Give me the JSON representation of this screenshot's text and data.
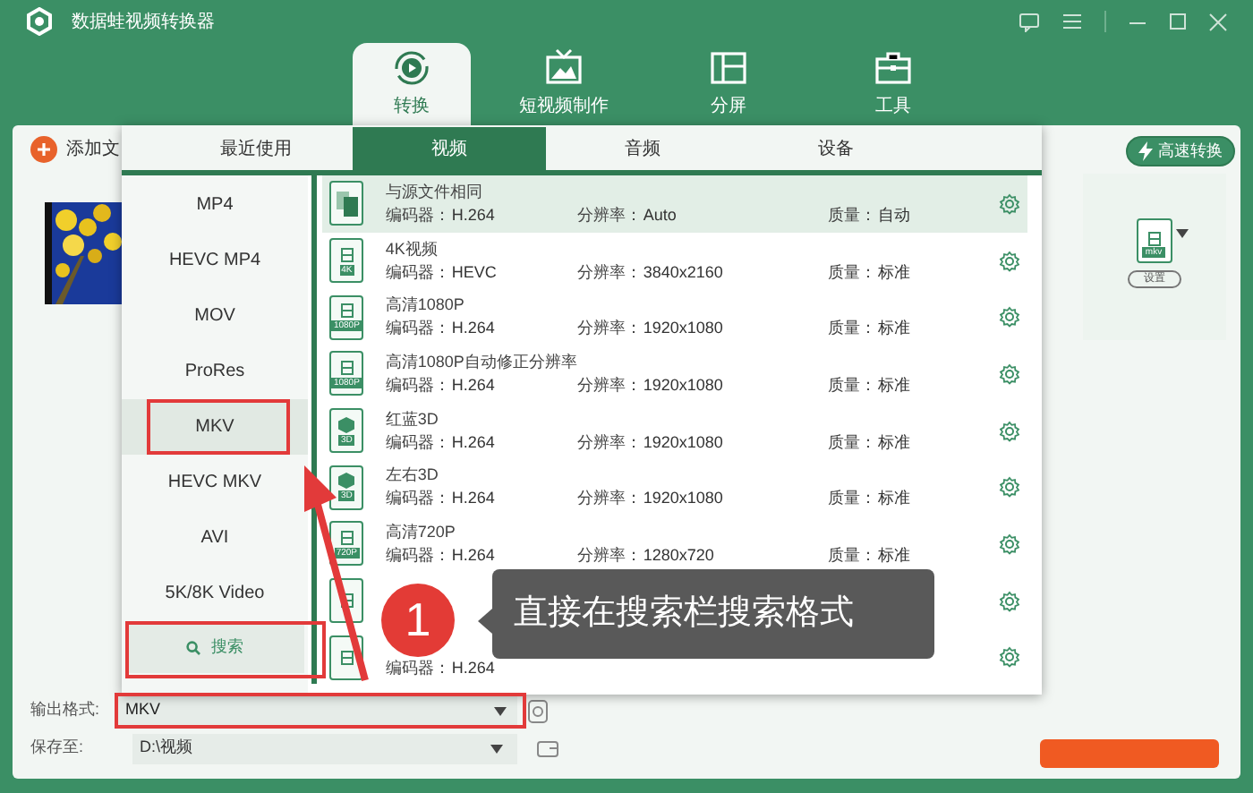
{
  "window": {
    "title": "数据蛙视频转换器"
  },
  "main_tabs": [
    {
      "label": "转换",
      "selected": true
    },
    {
      "label": "短视频制作",
      "selected": false
    },
    {
      "label": "分屏",
      "selected": false
    },
    {
      "label": "工具",
      "selected": false
    }
  ],
  "toolbar": {
    "add_file": "添加文",
    "fast_convert": "高速转换"
  },
  "output_panel": {
    "format_badge": "mkv",
    "settings_button": "设置"
  },
  "format_popup": {
    "tabs": [
      {
        "label": "最近使用",
        "selected": false
      },
      {
        "label": "视频",
        "selected": true
      },
      {
        "label": "音频",
        "selected": false
      },
      {
        "label": "设备",
        "selected": false
      }
    ],
    "categories": [
      {
        "label": "MP4",
        "selected": false
      },
      {
        "label": "HEVC MP4",
        "selected": false
      },
      {
        "label": "MOV",
        "selected": false
      },
      {
        "label": "ProRes",
        "selected": false
      },
      {
        "label": "MKV",
        "selected": true
      },
      {
        "label": "HEVC MKV",
        "selected": false
      },
      {
        "label": "AVI",
        "selected": false
      },
      {
        "label": "5K/8K Video",
        "selected": false
      }
    ],
    "search_button": "搜索",
    "presets": [
      {
        "kind": "same",
        "name": "与源文件相同",
        "codec_label": "编码器：",
        "codec": "H.264",
        "resolution_label": "分辨率：",
        "resolution": "Auto",
        "quality_label": "质量：",
        "quality": "自动",
        "selected": true
      },
      {
        "kind": "film",
        "badge": "4K",
        "name": "4K视频",
        "codec_label": "编码器：",
        "codec": "HEVC",
        "resolution_label": "分辨率：",
        "resolution": "3840x2160",
        "quality_label": "质量：",
        "quality": "标准",
        "selected": false
      },
      {
        "kind": "film",
        "badge": "1080P",
        "name": "高清1080P",
        "codec_label": "编码器：",
        "codec": "H.264",
        "resolution_label": "分辨率：",
        "resolution": "1920x1080",
        "quality_label": "质量：",
        "quality": "标准",
        "selected": false
      },
      {
        "kind": "film",
        "badge": "1080P",
        "name": "高清1080P自动修正分辨率",
        "codec_label": "编码器：",
        "codec": "H.264",
        "resolution_label": "分辨率：",
        "resolution": "1920x1080",
        "quality_label": "质量：",
        "quality": "标准",
        "selected": false
      },
      {
        "kind": "cube",
        "badge": "3D",
        "name": "红蓝3D",
        "codec_label": "编码器：",
        "codec": "H.264",
        "resolution_label": "分辨率：",
        "resolution": "1920x1080",
        "quality_label": "质量：",
        "quality": "标准",
        "selected": false
      },
      {
        "kind": "cube",
        "badge": "3D",
        "name": "左右3D",
        "codec_label": "编码器：",
        "codec": "H.264",
        "resolution_label": "分辨率：",
        "resolution": "1920x1080",
        "quality_label": "质量：",
        "quality": "标准",
        "selected": false
      },
      {
        "kind": "film",
        "badge": "720P",
        "name": "高清720P",
        "codec_label": "编码器：",
        "codec": "H.264",
        "resolution_label": "分辨率：",
        "resolution": "1280x720",
        "quality_label": "质量：",
        "quality": "标准",
        "selected": false
      },
      {
        "kind": "film",
        "selected": false
      },
      {
        "kind": "film",
        "codec_label": "编码器：",
        "codec": "H.264",
        "selected": false
      }
    ]
  },
  "bottom": {
    "output_format_label": "输出格式:",
    "output_format": "MKV",
    "save_to_label": "保存至:",
    "save_to": "D:\\视频"
  },
  "annotation": {
    "step": "1",
    "text": "直接在搜索栏搜索格式"
  }
}
